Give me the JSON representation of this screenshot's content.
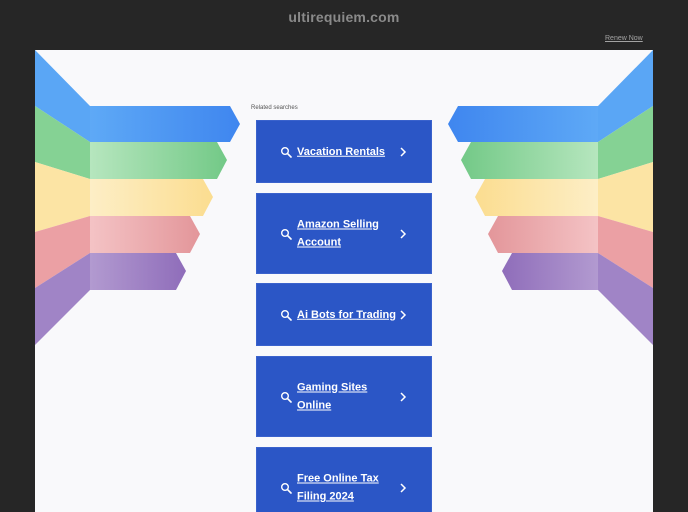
{
  "header": {
    "site_title": "ultirequiem.com",
    "renew_label": "Renew Now"
  },
  "main": {
    "related_label": "Related searches",
    "results": [
      {
        "label": "Vacation Rentals"
      },
      {
        "label": "Amazon Selling Account"
      },
      {
        "label": "Ai Bots for Trading"
      },
      {
        "label": "Gaming Sites Online"
      },
      {
        "label": "Free Online Tax Filing 2024"
      }
    ]
  },
  "icons": {
    "search": "search-icon",
    "chevron": "chevron-right-icon"
  },
  "colors": {
    "background": "#262626",
    "panel": "#f9f9fb",
    "card": "#2b56c6",
    "wing_blue": "#5aa6f5",
    "wing_green": "#7fcf8f",
    "wing_yellow": "#fce3a0",
    "wing_red": "#e99a9e",
    "wing_purple": "#9a7ac0"
  }
}
